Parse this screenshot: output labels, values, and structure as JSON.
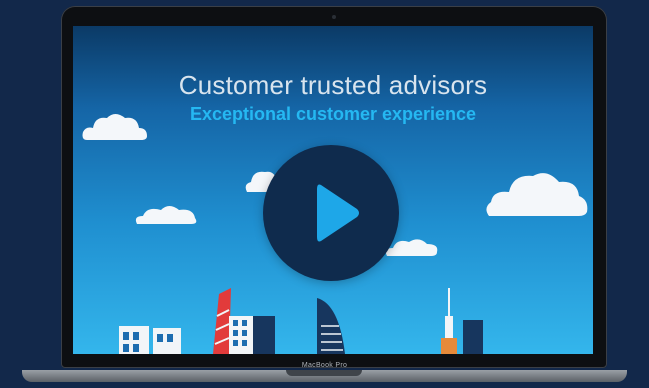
{
  "video": {
    "headline": "Customer trusted advisors",
    "subheadline": "Exceptional customer experience",
    "play_icon": "play-icon"
  },
  "device": {
    "model_label": "MacBook Pro"
  },
  "colors": {
    "background": "#12284a",
    "sky_top": "#0b3a66",
    "sky_bottom": "#34b6ec",
    "headline": "#d8e4ee",
    "subheadline": "#25b8f2",
    "play_button": "#0f2b4d",
    "play_glyph": "#1ea7e8"
  }
}
